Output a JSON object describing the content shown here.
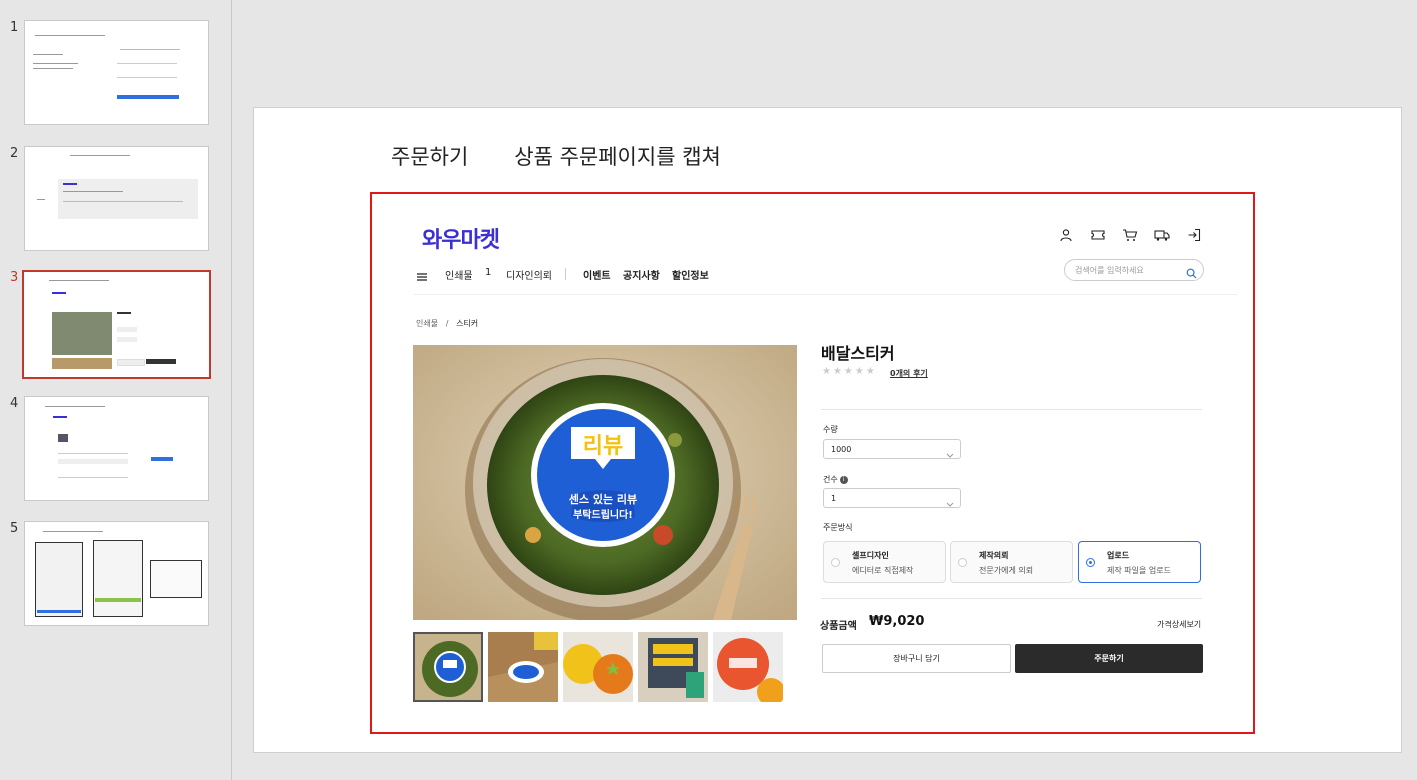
{
  "thumbnails": [
    {
      "number": "1"
    },
    {
      "number": "2"
    },
    {
      "number": "3"
    },
    {
      "number": "4"
    },
    {
      "number": "5"
    }
  ],
  "slide": {
    "title": "주문하기",
    "subtitle": "상품 주문페이지를 캡쳐"
  },
  "store": {
    "logo": "와우마켓",
    "header_icons": [
      "user-icon",
      "ticket-icon",
      "cart-icon",
      "truck-icon",
      "logout-icon"
    ],
    "nav": {
      "items": [
        "인쇄물",
        "1",
        "디자인의뢰"
      ],
      "bold_items": [
        "이벤트",
        "공지사항",
        "할인정보"
      ],
      "search_placeholder": "검색어를 입력하세요"
    },
    "breadcrumb": {
      "parent": "인쇄물",
      "separator": "/",
      "current": "스티커"
    },
    "product": {
      "title": "배달스티커",
      "stars": "★★★★★",
      "reviews": "0개의 후기",
      "sticker_main": "리뷰",
      "sticker_line1": "센스 있는 리뷰",
      "sticker_line2": "부탁드립니다!",
      "quantity_label": "수량",
      "quantity_value": "1000",
      "count_label": "건수",
      "count_value": "1",
      "order_method_label": "주문방식",
      "options": [
        {
          "title": "셀프디자인",
          "desc": "에디터로 직접제작",
          "selected": false
        },
        {
          "title": "제작의뢰",
          "desc": "전문가에게 의뢰",
          "selected": false
        },
        {
          "title": "업로드",
          "desc": "제작 파일을 업로드",
          "selected": true
        }
      ],
      "price_label": "상품금액",
      "price": "₩9,020",
      "price_detail": "가격상세보기",
      "cart_button": "장바구니 담기",
      "order_button": "주문하기"
    }
  },
  "colors": {
    "accent": "#2f6fe0",
    "logo": "#3b2fd6",
    "highlight": "#e01818"
  }
}
